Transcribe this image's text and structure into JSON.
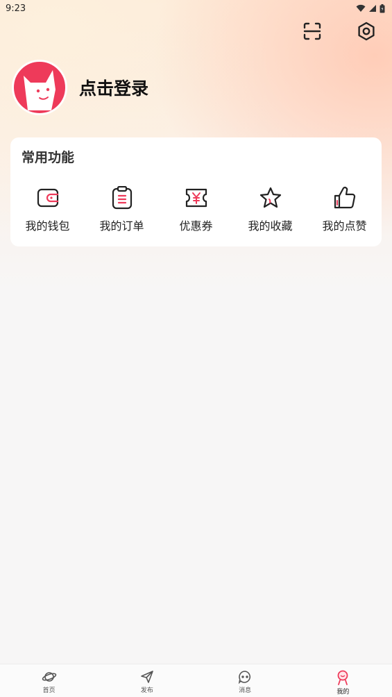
{
  "status": {
    "time": "9:23"
  },
  "header": {
    "scan_icon": "scan-icon",
    "settings_icon": "settings-icon"
  },
  "profile": {
    "login_label": "点击登录"
  },
  "common": {
    "title": "常用功能",
    "items": [
      {
        "label": "我的钱包",
        "icon": "wallet-icon"
      },
      {
        "label": "我的订单",
        "icon": "order-icon"
      },
      {
        "label": "优惠券",
        "icon": "coupon-icon"
      },
      {
        "label": "我的收藏",
        "icon": "star-icon"
      },
      {
        "label": "我的点赞",
        "icon": "thumbs-up-icon"
      }
    ]
  },
  "tabbar": {
    "items": [
      {
        "label": "首页",
        "icon": "planet-icon"
      },
      {
        "label": "发布",
        "icon": "send-icon"
      },
      {
        "label": "消息",
        "icon": "chat-icon"
      },
      {
        "label": "我的",
        "icon": "profile-icon"
      }
    ],
    "active_index": 3
  },
  "colors": {
    "accent": "#ee3a5a",
    "text": "#111111"
  }
}
